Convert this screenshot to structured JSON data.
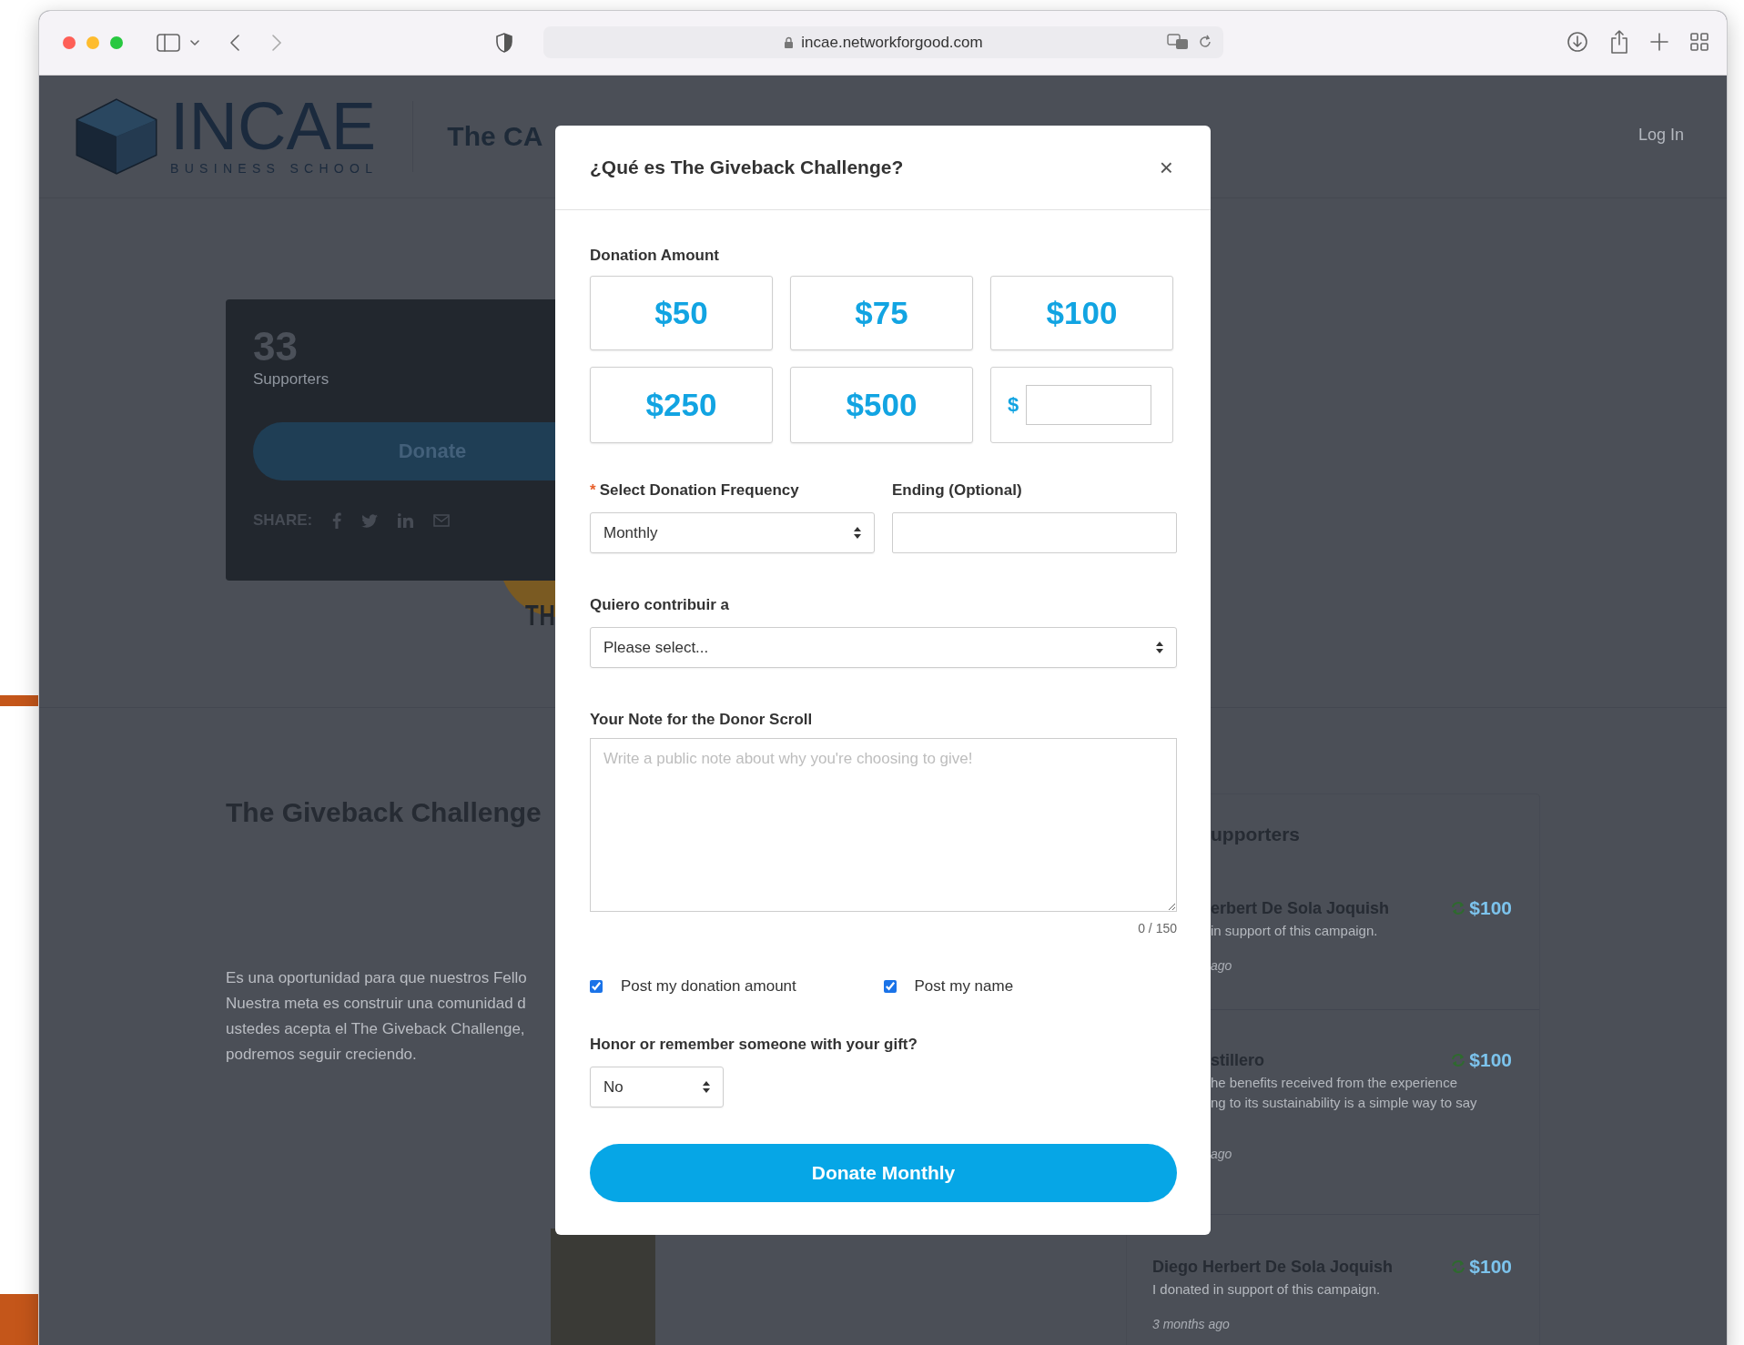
{
  "browser": {
    "url": "incae.networkforgood.com"
  },
  "header": {
    "logo_wordmark": "INCAE",
    "logo_tagline": "BUSINESS SCHOOL",
    "page_title": "The CA",
    "login": "Log In"
  },
  "stats_card": {
    "count": "33",
    "count_label": "Supporters",
    "donate_button": "Donate",
    "share_label": "SHARE:"
  },
  "banner_text": "TH",
  "about": {
    "heading": "The Giveback Challenge",
    "lines": [
      "Es una oportunidad para que nuestros Fello",
      "Nuestra meta es construir una comunidad d",
      "ustedes acepta el The Giveback Challenge,",
      "podremos seguir creciendo."
    ]
  },
  "supporters": {
    "heading": "upporters",
    "items": [
      {
        "name": "erbert De Sola Joquish",
        "lines": [
          "in support of this campaign."
        ],
        "time": "ago",
        "amount": "$100",
        "recurring": true,
        "under_modal": true
      },
      {
        "name": "stillero",
        "lines": [
          "he benefits received from the experience",
          "ng to its sustainability is a simple way to say"
        ],
        "time": "ago",
        "amount": "$100",
        "recurring": true,
        "under_modal": true
      },
      {
        "name": "Diego Herbert De Sola Joquish",
        "lines": [
          "I donated in support of this campaign."
        ],
        "time": "3 months ago",
        "amount": "$100",
        "recurring": true,
        "under_modal": false
      }
    ]
  },
  "modal": {
    "title": "¿Qué es The Giveback Challenge?",
    "close": "×",
    "amount_label": "Donation Amount",
    "amounts": [
      {
        "kind": "preset",
        "label": "$50",
        "selected": false
      },
      {
        "kind": "preset",
        "label": "$75",
        "selected": false
      },
      {
        "kind": "preset",
        "label": "$100",
        "selected": false
      },
      {
        "kind": "preset",
        "label": "$250",
        "selected": false
      },
      {
        "kind": "preset",
        "label": "$500",
        "selected": false
      },
      {
        "kind": "custom",
        "prefix": "$",
        "selected": false
      }
    ],
    "frequency": {
      "required_mark": "*",
      "label": "Select Donation Frequency",
      "value": "Monthly"
    },
    "ending": {
      "label": "Ending (Optional)"
    },
    "contribute": {
      "label": "Quiero contribuir a",
      "value": "Please select..."
    },
    "note": {
      "label": "Your Note for the Donor Scroll",
      "placeholder": "Write a public note about why you're choosing to give!",
      "counter": "0 / 150"
    },
    "checkboxes": [
      {
        "label": "Post my donation amount",
        "checked": true
      },
      {
        "label": "Post my name",
        "checked": true
      }
    ],
    "honor": {
      "label": "Honor or remember someone with your gift?",
      "value": "No"
    },
    "submit": "Donate Monthly"
  }
}
